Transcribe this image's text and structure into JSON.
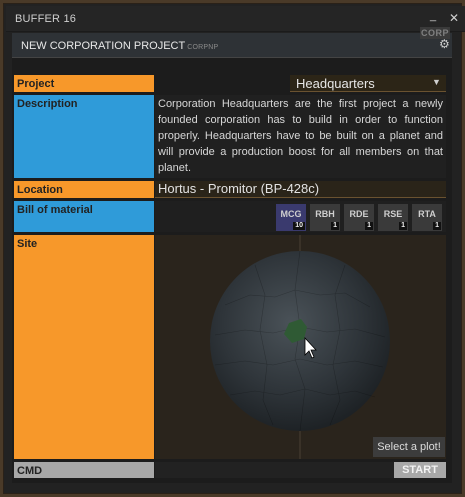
{
  "window": {
    "title": "BUFFER 16"
  },
  "panel": {
    "title": "NEW CORPORATION PROJECT",
    "code": "CORPNP",
    "corp_tag": "CORP"
  },
  "labels": {
    "project": "Project",
    "description": "Description",
    "location": "Location",
    "bill_of_material": "Bill of material",
    "site": "Site",
    "cmd": "CMD"
  },
  "project": {
    "selected": "Headquarters"
  },
  "description": "Corporation Headquarters are the first project a newly founded corporation has to build in order to function properly. Headquarters have to be built on a planet and will provide a production boost for all members on that planet.",
  "location": "Hortus - Promitor (BP-428c)",
  "materials": [
    {
      "ticker": "MCG",
      "amount": "10"
    },
    {
      "ticker": "RBH",
      "amount": "1"
    },
    {
      "ticker": "RDE",
      "amount": "1"
    },
    {
      "ticker": "RSE",
      "amount": "1"
    },
    {
      "ticker": "RTA",
      "amount": "1"
    }
  ],
  "site": {
    "hint": "Select a plot!"
  },
  "actions": {
    "start": "START"
  },
  "icons": {
    "min": "minimize-icon",
    "close": "close-icon",
    "settings": "gear-icon",
    "dropdown": "dropdown-caret-icon"
  },
  "colors": {
    "orange_label": "#f7982a",
    "blue_label": "#2f9bd9",
    "gray_label": "#a8a8a8",
    "mcg_badge": "#3a3a6e"
  }
}
